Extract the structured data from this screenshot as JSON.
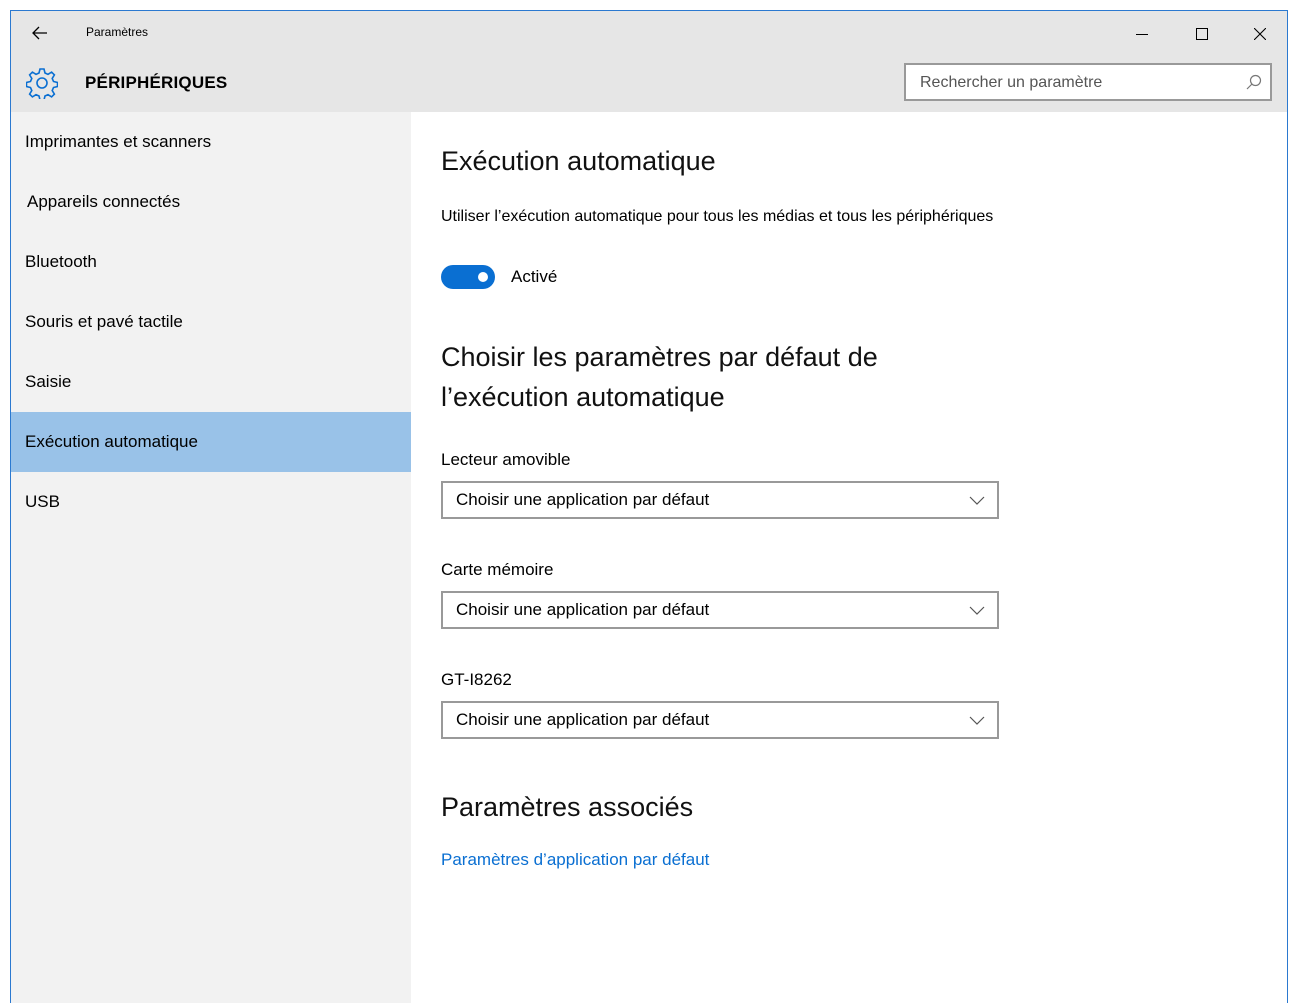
{
  "window": {
    "title": "Paramètres",
    "back_icon": "back-arrow-icon",
    "controls": {
      "minimize_icon": "minimize-icon",
      "maximize_icon": "maximize-icon",
      "close_icon": "close-icon"
    }
  },
  "header": {
    "icon": "gear-icon",
    "title": "PÉRIPHÉRIQUES",
    "search": {
      "placeholder": "Rechercher un paramètre",
      "icon": "search-icon"
    }
  },
  "sidebar": {
    "selected_index": 5,
    "items": [
      {
        "label": "Imprimantes et scanners"
      },
      {
        "label": "Appareils connectés"
      },
      {
        "label": "Bluetooth"
      },
      {
        "label": "Souris et pavé tactile"
      },
      {
        "label": "Saisie"
      },
      {
        "label": "Exécution automatique"
      },
      {
        "label": "USB"
      }
    ]
  },
  "main": {
    "section1": {
      "title": "Exécution automatique",
      "description": "Utiliser l’exécution automatique pour tous les médias et tous les périphériques",
      "toggle": {
        "state": "on",
        "label": "Activé"
      }
    },
    "section2": {
      "title_line1": "Choisir les paramètres par défaut de",
      "title_line2": "l’exécution automatique",
      "fields": [
        {
          "label": "Lecteur amovible",
          "value": "Choisir une application par défaut"
        },
        {
          "label": "Carte mémoire",
          "value": "Choisir une application par défaut"
        },
        {
          "label": "GT-I8262",
          "value": "Choisir une application par défaut"
        }
      ]
    },
    "section3": {
      "title": "Paramètres associés",
      "link": "Paramètres d’application par défaut"
    }
  },
  "colors": {
    "accent": "#0a6fd2",
    "selected_nav": "#99c2e8",
    "sidebar_bg": "#f2f2f2",
    "titlebar_bg": "#e6e6e6"
  }
}
